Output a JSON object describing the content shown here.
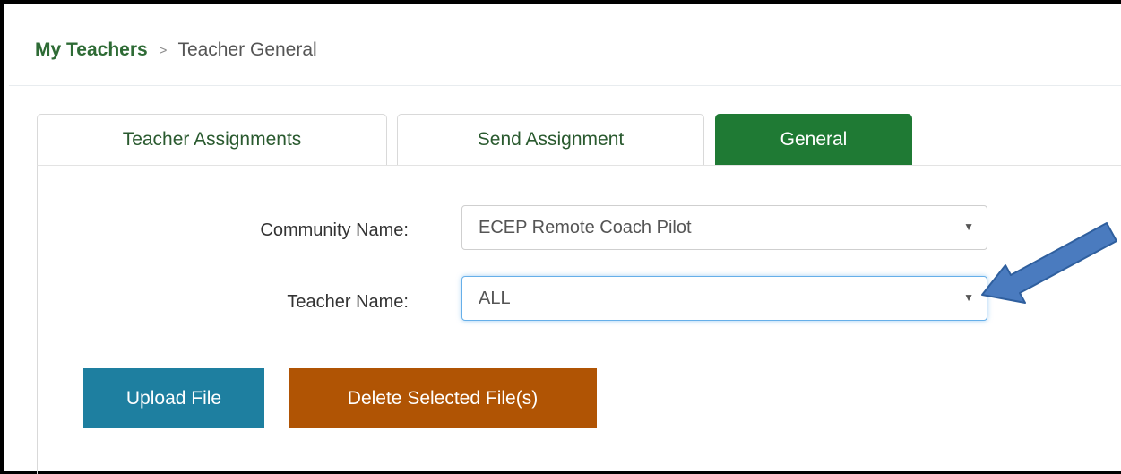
{
  "breadcrumb": {
    "parent": "My Teachers",
    "separator": ">",
    "current": "Teacher General"
  },
  "tabs": [
    {
      "label": "Teacher Assignments",
      "active": false
    },
    {
      "label": "Send Assignment",
      "active": false
    },
    {
      "label": "General",
      "active": true
    }
  ],
  "form": {
    "community": {
      "label": "Community Name:",
      "value": "ECEP Remote Coach Pilot"
    },
    "teacher": {
      "label": "Teacher Name:",
      "value": "ALL"
    }
  },
  "buttons": {
    "upload": "Upload File",
    "delete": "Delete Selected File(s)"
  },
  "icons": {
    "dropdown_caret": "▼",
    "annotation": "blue-arrow-icon"
  },
  "colors": {
    "brand_green": "#1f7a34",
    "link_green": "#2e6b35",
    "upload_blue": "#1e7fa0",
    "delete_orange": "#b05404",
    "annotation_arrow": "#4a7bbf",
    "focus_ring": "#66afe9"
  }
}
